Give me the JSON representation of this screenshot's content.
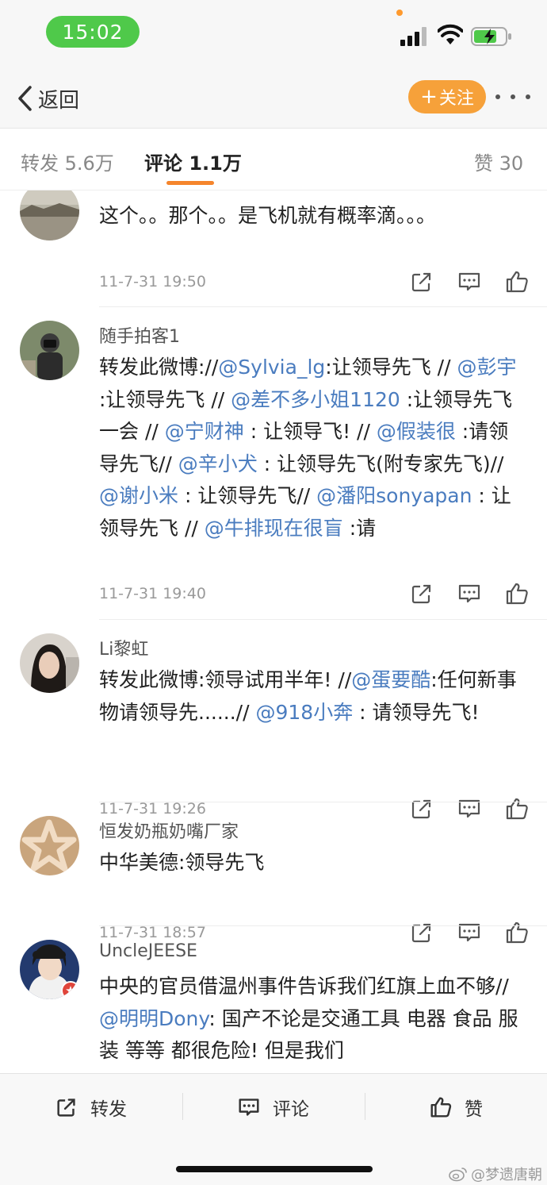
{
  "status_bar": {
    "time": "15:02",
    "colors": {
      "time_pill": "#4fc94a",
      "battery_fill": "#4fc94a"
    }
  },
  "nav": {
    "back_label": "返回",
    "follow_plus": "+",
    "follow_label": "关注",
    "colors": {
      "follow_button": "#f6a13a"
    }
  },
  "tabs": {
    "repost": "转发 5.6万",
    "comment": "评论 1.1万",
    "like": "赞 30",
    "colors": {
      "active_underline": "#f5852c"
    }
  },
  "comments": [
    {
      "username": "",
      "text": [
        {
          "t": "这个。。那个。。是飞机就有概率滴。。。"
        }
      ],
      "time": "11-7-31 19:50"
    },
    {
      "username": "随手拍客1",
      "text": [
        {
          "t": "转发此微博://"
        },
        {
          "t": "@Sylvia_lg",
          "m": true
        },
        {
          "t": ":让领导先飞 // "
        },
        {
          "t": "@彭宇",
          "m": true
        },
        {
          "t": " :让领导先飞 // "
        },
        {
          "t": "@差不多小姐1120",
          "m": true
        },
        {
          "t": " :让领导先飞一会 // "
        },
        {
          "t": "@宁财神",
          "m": true
        },
        {
          "t": " : 让领导飞! // "
        },
        {
          "t": "@假装很",
          "m": true
        },
        {
          "t": " :请领导先飞// "
        },
        {
          "t": "@辛小犬",
          "m": true
        },
        {
          "t": " : 让领导先飞(附专家先飞)// "
        },
        {
          "t": "@谢小米",
          "m": true
        },
        {
          "t": " : 让领导先飞// "
        },
        {
          "t": "@潘阳sonyapan",
          "m": true
        },
        {
          "t": " : 让领导先飞 // "
        },
        {
          "t": "@牛排现在很盲",
          "m": true
        },
        {
          "t": " :请"
        }
      ],
      "time": "11-7-31 19:40"
    },
    {
      "username": "Li黎虹",
      "text": [
        {
          "t": "转发此微博:领导试用半年! //"
        },
        {
          "t": "@蛋要酷",
          "m": true
        },
        {
          "t": ":任何新事物请领导先......// "
        },
        {
          "t": "@918小奔",
          "m": true
        },
        {
          "t": " : 请领导先飞!"
        }
      ],
      "time": "11-7-31 19:26"
    },
    {
      "username": "恒发奶瓶奶嘴厂家",
      "text": [
        {
          "t": "中华美德:领导先飞"
        }
      ],
      "time": "11-7-31 18:57"
    },
    {
      "username": "UncleJEESE",
      "text": [
        {
          "t": "中央的官员借温州事件告诉我们红旗上血不够//"
        },
        {
          "t": "@明明Dony",
          "m": true
        },
        {
          "t": ": 国产不论是交通工具 电器 食品 服装 等等 都很危险! 但是我们"
        }
      ],
      "time": ""
    }
  ],
  "bottom_bar": {
    "repost": "转发",
    "comment": "评论",
    "like": "赞",
    "watermark": "@梦遗唐朝"
  },
  "icons": {
    "status": [
      "signal-icon",
      "wifi-icon",
      "battery-icon"
    ],
    "actions": [
      "share-icon",
      "comment-icon",
      "like-icon"
    ],
    "watermark": "weibo-logo-icon"
  },
  "colors": {
    "mention": "#4a7cbf",
    "text": "#222222",
    "muted": "#999999"
  }
}
